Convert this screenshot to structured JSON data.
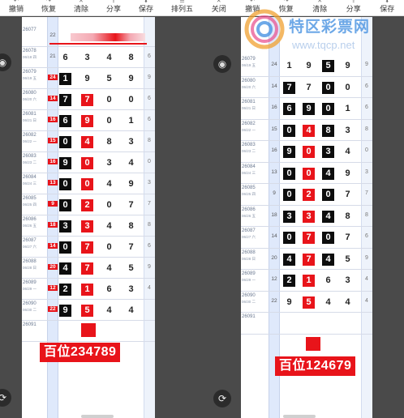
{
  "left": {
    "toolbar": [
      {
        "label": "撤销",
        "icon": "undo-icon"
      },
      {
        "label": "恢复",
        "icon": "redo-icon"
      },
      {
        "label": "清除",
        "icon": "clear-icon"
      },
      {
        "label": "分享",
        "icon": "share-icon"
      },
      {
        "label": "保存",
        "icon": "save-icon"
      },
      {
        "label": "排列五",
        "icon": "lottery-type-icon"
      }
    ],
    "rows": [
      {
        "period": "26077",
        "date": "",
        "sum": "22",
        "sum_red": false,
        "digits": [
          "",
          "",
          "",
          ""
        ],
        "styles": [
          "",
          "",
          "",
          ""
        ],
        "extra": ""
      },
      {
        "period": "26078",
        "date": "06/18 四",
        "sum": "21",
        "sum_red": false,
        "digits": [
          "6",
          "3",
          "4",
          "8"
        ],
        "styles": [
          "",
          "",
          "",
          ""
        ],
        "extra": "6"
      },
      {
        "period": "26079",
        "date": "06/19 五",
        "sum": "24",
        "sum_red": true,
        "digits": [
          "1",
          "9",
          "5",
          "9"
        ],
        "styles": [
          "black",
          "",
          "",
          ""
        ],
        "extra": "9"
      },
      {
        "period": "26080",
        "date": "06/20 六",
        "sum": "14",
        "sum_red": true,
        "digits": [
          "7",
          "7",
          "0",
          "0"
        ],
        "styles": [
          "black",
          "red",
          "",
          ""
        ],
        "extra": "6"
      },
      {
        "period": "26081",
        "date": "06/21 日",
        "sum": "16",
        "sum_red": true,
        "digits": [
          "6",
          "9",
          "0",
          "1"
        ],
        "styles": [
          "black",
          "red",
          "",
          ""
        ],
        "extra": "6"
      },
      {
        "period": "26082",
        "date": "06/22 一",
        "sum": "15",
        "sum_red": true,
        "digits": [
          "0",
          "4",
          "8",
          "3"
        ],
        "styles": [
          "black",
          "red",
          "",
          ""
        ],
        "extra": "8"
      },
      {
        "period": "26083",
        "date": "06/23 二",
        "sum": "16",
        "sum_red": true,
        "digits": [
          "9",
          "0",
          "3",
          "4"
        ],
        "styles": [
          "black",
          "red",
          "",
          ""
        ],
        "extra": "0"
      },
      {
        "period": "26084",
        "date": "06/24 三",
        "sum": "13",
        "sum_red": true,
        "digits": [
          "0",
          "0",
          "4",
          "9"
        ],
        "styles": [
          "black",
          "red",
          "",
          ""
        ],
        "extra": "3"
      },
      {
        "period": "26085",
        "date": "06/25 四",
        "sum": "9",
        "sum_red": true,
        "digits": [
          "0",
          "2",
          "0",
          "7"
        ],
        "styles": [
          "black",
          "red",
          "",
          ""
        ],
        "extra": "7"
      },
      {
        "period": "26086",
        "date": "06/26 五",
        "sum": "18",
        "sum_red": true,
        "digits": [
          "3",
          "3",
          "4",
          "8"
        ],
        "styles": [
          "black",
          "red",
          "",
          ""
        ],
        "extra": "8"
      },
      {
        "period": "26087",
        "date": "06/27 六",
        "sum": "14",
        "sum_red": true,
        "digits": [
          "0",
          "7",
          "0",
          "7"
        ],
        "styles": [
          "black",
          "red",
          "",
          ""
        ],
        "extra": "6"
      },
      {
        "period": "26088",
        "date": "06/28 日",
        "sum": "20",
        "sum_red": true,
        "digits": [
          "4",
          "7",
          "4",
          "5"
        ],
        "styles": [
          "black",
          "red",
          "",
          ""
        ],
        "extra": "9"
      },
      {
        "period": "26089",
        "date": "06/29 一",
        "sum": "12",
        "sum_red": true,
        "digits": [
          "2",
          "1",
          "6",
          "3"
        ],
        "styles": [
          "black",
          "red",
          "",
          ""
        ],
        "extra": "4"
      },
      {
        "period": "26090",
        "date": "06/30 二",
        "sum": "22",
        "sum_red": true,
        "digits": [
          "9",
          "5",
          "4",
          "4"
        ],
        "styles": [
          "black",
          "red",
          "",
          ""
        ],
        "extra": ""
      },
      {
        "period": "26091",
        "date": "",
        "sum": "",
        "sum_red": false,
        "digits": [
          "",
          "",
          "",
          ""
        ],
        "styles": [
          "",
          "",
          "",
          ""
        ],
        "extra": ""
      }
    ],
    "banner": "百位234789"
  },
  "right": {
    "toolbar": [
      {
        "label": "关闭",
        "icon": "close-icon"
      },
      {
        "label": "撤销",
        "icon": "undo-icon"
      },
      {
        "label": "恢复",
        "icon": "redo-icon"
      },
      {
        "label": "清除",
        "icon": "clear-icon"
      },
      {
        "label": "分享",
        "icon": "share-icon"
      },
      {
        "label": "保存",
        "icon": "save-icon"
      }
    ],
    "rows": [
      {
        "period": "26079",
        "date": "06/19 五",
        "sum": "24",
        "sum_red": false,
        "digits": [
          "1",
          "9",
          "5",
          "9"
        ],
        "styles": [
          "",
          "",
          "black",
          ""
        ],
        "extra": "9"
      },
      {
        "period": "26080",
        "date": "06/20 六",
        "sum": "14",
        "sum_red": false,
        "digits": [
          "7",
          "7",
          "0",
          "0"
        ],
        "styles": [
          "black",
          "",
          "black",
          ""
        ],
        "extra": "6"
      },
      {
        "period": "26081",
        "date": "06/21 日",
        "sum": "16",
        "sum_red": false,
        "digits": [
          "6",
          "9",
          "0",
          "1"
        ],
        "styles": [
          "black",
          "black",
          "black",
          ""
        ],
        "extra": "6"
      },
      {
        "period": "26082",
        "date": "06/22 一",
        "sum": "15",
        "sum_red": false,
        "digits": [
          "0",
          "4",
          "8",
          "3"
        ],
        "styles": [
          "black",
          "red",
          "black",
          ""
        ],
        "extra": "8"
      },
      {
        "period": "26083",
        "date": "06/23 二",
        "sum": "16",
        "sum_red": false,
        "digits": [
          "9",
          "0",
          "3",
          "4"
        ],
        "styles": [
          "black",
          "red",
          "black",
          ""
        ],
        "extra": "0"
      },
      {
        "period": "26084",
        "date": "06/24 三",
        "sum": "13",
        "sum_red": false,
        "digits": [
          "0",
          "0",
          "4",
          "9"
        ],
        "styles": [
          "black",
          "red",
          "black",
          ""
        ],
        "extra": "3"
      },
      {
        "period": "26085",
        "date": "06/25 四",
        "sum": "9",
        "sum_red": false,
        "digits": [
          "0",
          "2",
          "0",
          "7"
        ],
        "styles": [
          "black",
          "red",
          "black",
          ""
        ],
        "extra": "7"
      },
      {
        "period": "26086",
        "date": "06/26 五",
        "sum": "18",
        "sum_red": false,
        "digits": [
          "3",
          "3",
          "4",
          "8"
        ],
        "styles": [
          "black",
          "red",
          "black",
          ""
        ],
        "extra": "8"
      },
      {
        "period": "26087",
        "date": "06/27 六",
        "sum": "14",
        "sum_red": false,
        "digits": [
          "0",
          "7",
          "0",
          "7"
        ],
        "styles": [
          "black",
          "red",
          "black",
          ""
        ],
        "extra": "6"
      },
      {
        "period": "26088",
        "date": "06/28 日",
        "sum": "20",
        "sum_red": false,
        "digits": [
          "4",
          "7",
          "4",
          "5"
        ],
        "styles": [
          "black",
          "red",
          "black",
          ""
        ],
        "extra": "9"
      },
      {
        "period": "26089",
        "date": "06/29 一",
        "sum": "12",
        "sum_red": false,
        "digits": [
          "2",
          "1",
          "6",
          "3"
        ],
        "styles": [
          "black",
          "red",
          "",
          ""
        ],
        "extra": "4"
      },
      {
        "period": "26090",
        "date": "06/30 二",
        "sum": "22",
        "sum_red": false,
        "digits": [
          "9",
          "5",
          "4",
          "4"
        ],
        "styles": [
          "",
          "red",
          "",
          ""
        ],
        "extra": "4"
      },
      {
        "period": "26091",
        "date": "",
        "sum": "",
        "sum_red": false,
        "digits": [
          "",
          "",
          "",
          ""
        ],
        "styles": [
          "",
          "",
          "",
          ""
        ],
        "extra": ""
      }
    ],
    "banner": "百位124679"
  },
  "watermark": {
    "name": "特区彩票网",
    "url": "www.tqcp.net"
  },
  "colors": {
    "red": "#e8141a",
    "black": "#0d0d0d",
    "blue_col": "#dfe9fb"
  }
}
